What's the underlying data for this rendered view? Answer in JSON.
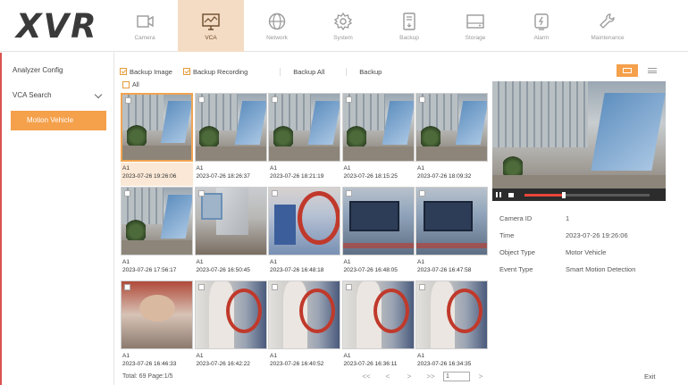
{
  "brand": "XVR",
  "nav": [
    {
      "label": "Camera",
      "icon": "camera-icon",
      "active": false
    },
    {
      "label": "VCA",
      "icon": "vca-monitor-icon",
      "active": true
    },
    {
      "label": "Network",
      "icon": "globe-icon",
      "active": false
    },
    {
      "label": "System",
      "icon": "gear-icon",
      "active": false
    },
    {
      "label": "Backup",
      "icon": "backup-icon",
      "active": false
    },
    {
      "label": "Storage",
      "icon": "storage-icon",
      "active": false
    },
    {
      "label": "Alarm",
      "icon": "alarm-icon",
      "active": false
    },
    {
      "label": "Maintenance",
      "icon": "wrench-icon",
      "active": false
    }
  ],
  "sidebar": {
    "analyzer_config": "Analyzer Config",
    "vca_search": "VCA Search",
    "active_sub": "Motion Vehicle"
  },
  "toolbar": {
    "backup_image": "Backup Image",
    "backup_recording": "Backup Recording",
    "backup_all": "Backup All",
    "backup": "Backup",
    "all": "All"
  },
  "results": [
    {
      "camera": "A1",
      "time": "2023-07-26 19:26:06",
      "scene": "office",
      "selected": true
    },
    {
      "camera": "A1",
      "time": "2023-07-26 18:26:37",
      "scene": "office",
      "selected": false
    },
    {
      "camera": "A1",
      "time": "2023-07-26 18:21:19",
      "scene": "office",
      "selected": false
    },
    {
      "camera": "A1",
      "time": "2023-07-26 18:15:25",
      "scene": "office",
      "selected": false
    },
    {
      "camera": "A1",
      "time": "2023-07-26 18:09:32",
      "scene": "office",
      "selected": false
    },
    {
      "camera": "A1",
      "time": "2023-07-26 17:56:17",
      "scene": "office",
      "selected": false
    },
    {
      "camera": "A1",
      "time": "2023-07-26 16:50:45",
      "scene": "room",
      "selected": false
    },
    {
      "camera": "A1",
      "time": "2023-07-26 16:48:18",
      "scene": "cables",
      "selected": false
    },
    {
      "camera": "A1",
      "time": "2023-07-26 16:48:05",
      "scene": "desk",
      "selected": false
    },
    {
      "camera": "A1",
      "time": "2023-07-26 16:47:58",
      "scene": "desk",
      "selected": false
    },
    {
      "camera": "A1",
      "time": "2023-07-26 16:46:33",
      "scene": "face",
      "selected": false
    },
    {
      "camera": "A1",
      "time": "2023-07-26 16:42:22",
      "scene": "blur",
      "selected": false
    },
    {
      "camera": "A1",
      "time": "2023-07-26 16:40:52",
      "scene": "blur",
      "selected": false
    },
    {
      "camera": "A1",
      "time": "2023-07-26 16:36:11",
      "scene": "blur",
      "selected": false
    },
    {
      "camera": "A1",
      "time": "2023-07-26 16:34:35",
      "scene": "blur",
      "selected": false
    }
  ],
  "preview": {
    "playback_progress": 0.3
  },
  "details": {
    "camera_id_label": "Camera ID",
    "camera_id": "1",
    "time_label": "Time",
    "time": "2023-07-26 19:26:06",
    "object_type_label": "Object Type",
    "object_type": "Motor Vehicle",
    "event_type_label": "Event Type",
    "event_type": "Smart Motion Detection"
  },
  "footer": {
    "total": "Total: 69  Page:1/5",
    "page_input": "1",
    "first": "<<",
    "prev": "<",
    "next": ">",
    "last": ">>",
    "go": ">",
    "exit": "Exit"
  },
  "colors": {
    "accent": "#f5a04b",
    "active_tab_bg": "#f4dcc4",
    "selected_thumb": "#fbe8d6"
  }
}
